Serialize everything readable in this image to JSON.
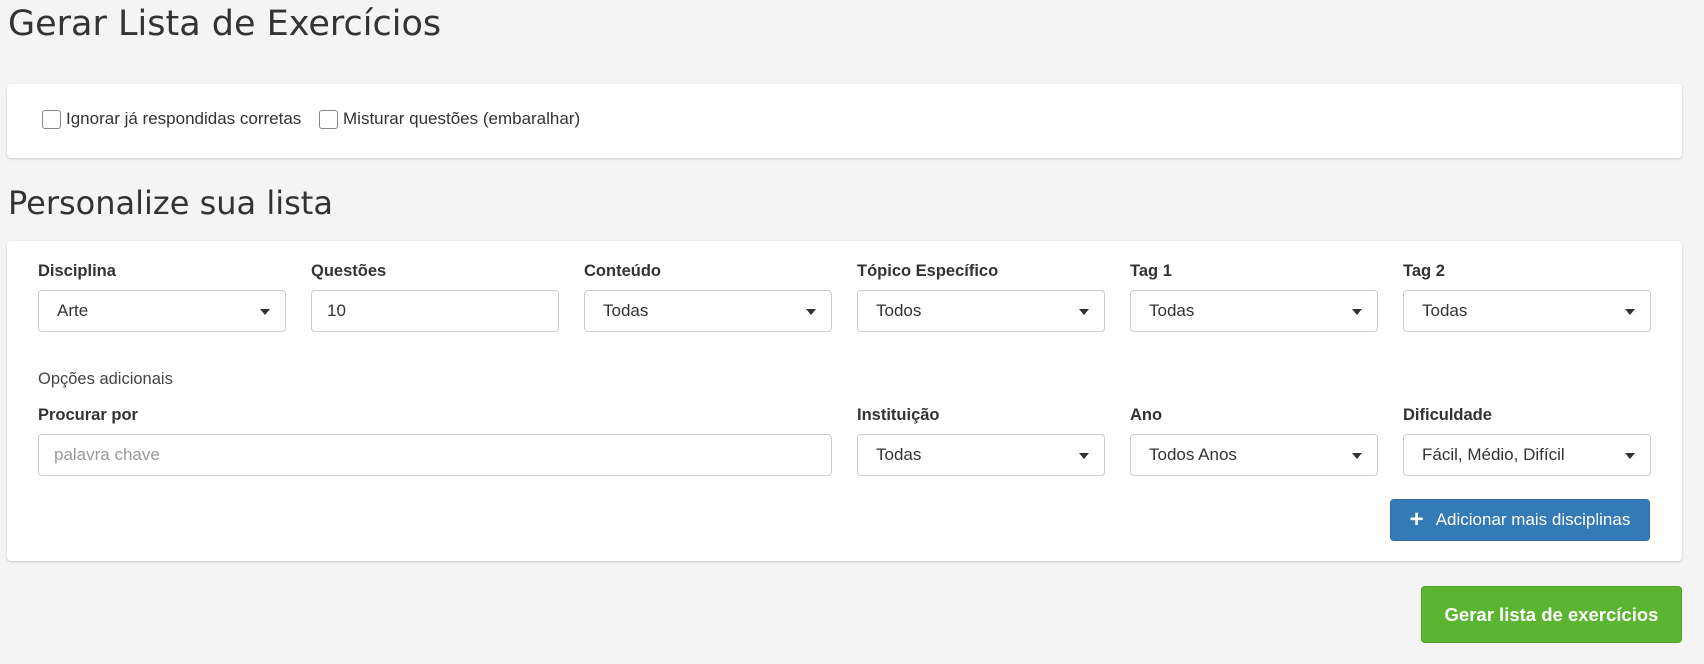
{
  "page_title": "Gerar Lista de Exercícios",
  "options": {
    "ignore_label": "Ignorar já respondidas corretas",
    "ignore_checked": false,
    "shuffle_label": "Misturar questões (embaralhar)",
    "shuffle_checked": false
  },
  "section_title": "Personalize sua lista",
  "filters": {
    "disciplina": {
      "label": "Disciplina",
      "value": "Arte"
    },
    "questoes": {
      "label": "Questões",
      "value": "10"
    },
    "conteudo": {
      "label": "Conteúdo",
      "value": "Todas"
    },
    "topico": {
      "label": "Tópico Específico",
      "value": "Todos"
    },
    "tag1": {
      "label": "Tag 1",
      "value": "Todas"
    },
    "tag2": {
      "label": "Tag 2",
      "value": "Todas"
    }
  },
  "additional": {
    "heading": "Opções adicionais",
    "search": {
      "label": "Procurar por",
      "placeholder": "palavra chave",
      "value": ""
    },
    "instituicao": {
      "label": "Instituição",
      "value": "Todas"
    },
    "ano": {
      "label": "Ano",
      "value": "Todos Anos"
    },
    "dificuldade": {
      "label": "Dificuldade",
      "value": "Fácil, Médio, Difícil"
    }
  },
  "buttons": {
    "add_label": "Adicionar mais disciplinas",
    "add_icon": "plus-icon",
    "generate_label": "Gerar lista de exercícios"
  },
  "colors": {
    "primary": "#337ab7",
    "success": "#5cb531",
    "background": "#f4f4f4"
  }
}
